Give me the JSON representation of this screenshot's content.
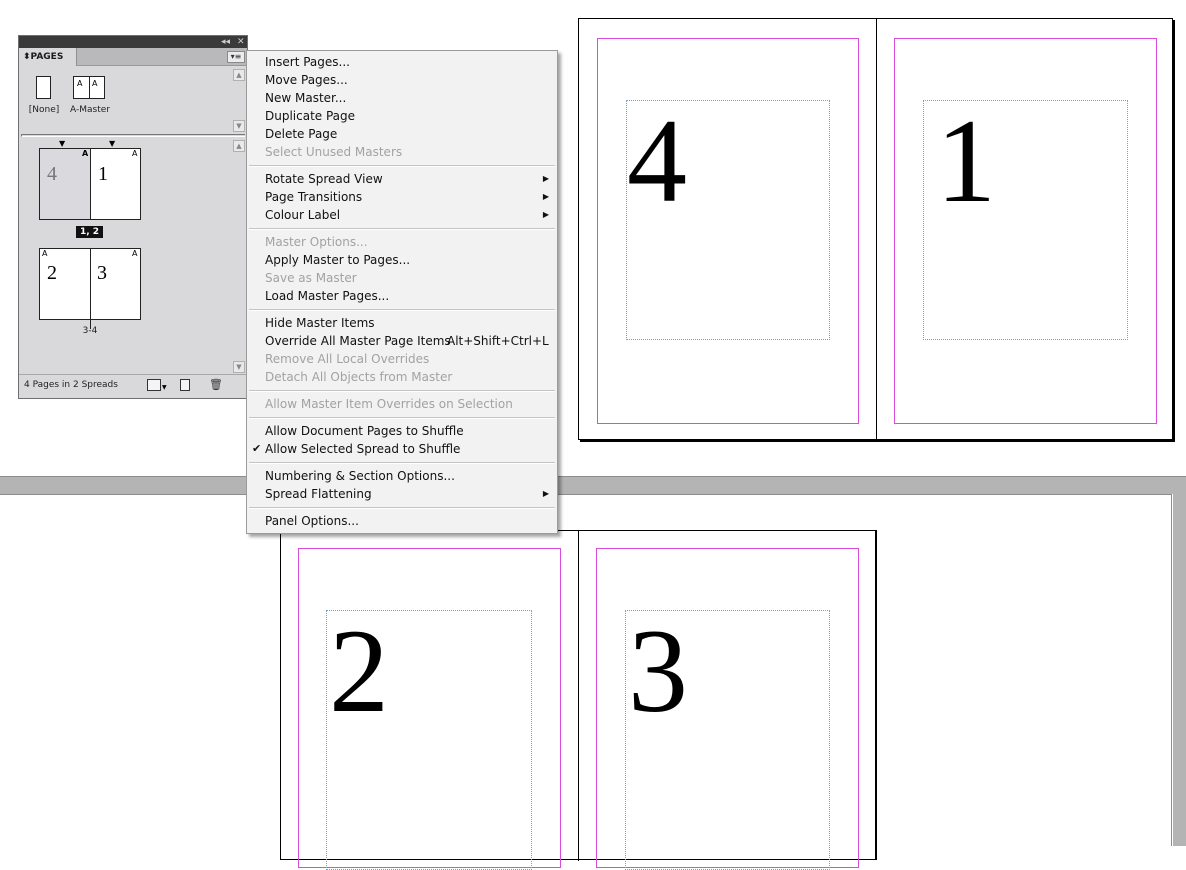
{
  "pages_panel": {
    "tab_title": "PAGES",
    "collapse_glyph": "◂◂",
    "close_glyph": "✕",
    "menu_glyph": "▾≡",
    "masters": [
      {
        "label": "[None]"
      },
      {
        "label": "A-Master",
        "left_prefix": "A",
        "right_prefix": "A"
      }
    ],
    "spreads": [
      {
        "left_page": "4",
        "right_page": "1",
        "label": "1, 2",
        "selected": true,
        "left_prefix": "",
        "right_prefix": "A",
        "center_prefix": "A"
      },
      {
        "left_page": "2",
        "right_page": "3",
        "label": "3-4",
        "selected": false,
        "left_prefix": "A",
        "right_prefix": "A"
      }
    ],
    "status": "4 Pages in 2 Spreads",
    "icons": [
      "edit-page-size-icon",
      "new-page-icon",
      "delete-page-icon"
    ]
  },
  "context_menu": {
    "items": [
      {
        "label": "Insert Pages...",
        "enabled": true
      },
      {
        "label": "Move Pages...",
        "enabled": true
      },
      {
        "label": "New Master...",
        "enabled": true
      },
      {
        "label": "Duplicate Page",
        "enabled": true
      },
      {
        "label": "Delete Page",
        "enabled": true
      },
      {
        "label": "Select Unused Masters",
        "enabled": false
      },
      {
        "separator": true
      },
      {
        "label": "Rotate Spread View",
        "enabled": true,
        "submenu": true
      },
      {
        "label": "Page Transitions",
        "enabled": true,
        "submenu": true
      },
      {
        "label": "Colour Label",
        "enabled": true,
        "submenu": true
      },
      {
        "separator": true
      },
      {
        "label": "Master Options...",
        "enabled": false
      },
      {
        "label": "Apply Master to Pages...",
        "enabled": true
      },
      {
        "label": "Save as Master",
        "enabled": false
      },
      {
        "label": "Load Master Pages...",
        "enabled": true
      },
      {
        "separator": true
      },
      {
        "label": "Hide Master Items",
        "enabled": true
      },
      {
        "label": "Override All Master Page Items",
        "enabled": true,
        "shortcut": "Alt+Shift+Ctrl+L"
      },
      {
        "label": "Remove All Local Overrides",
        "enabled": false
      },
      {
        "label": "Detach All Objects from Master",
        "enabled": false
      },
      {
        "separator": true
      },
      {
        "label": "Allow Master Item Overrides on Selection",
        "enabled": false
      },
      {
        "separator": true
      },
      {
        "label": "Allow Document Pages to Shuffle",
        "enabled": true
      },
      {
        "label": "Allow Selected Spread to Shuffle",
        "enabled": true,
        "checked": true
      },
      {
        "separator": true
      },
      {
        "label": "Numbering & Section Options...",
        "enabled": true
      },
      {
        "label": "Spread Flattening",
        "enabled": true,
        "submenu": true
      },
      {
        "separator": true
      },
      {
        "label": "Panel Options...",
        "enabled": true
      }
    ]
  },
  "document": {
    "spread1": {
      "left_page": "4",
      "right_page": "1"
    },
    "spread2": {
      "left_page": "2",
      "right_page": "3"
    }
  },
  "colors": {
    "margin_guide": "#d84bdc",
    "frame_guide": "#6fa0d8",
    "pasteboard_gap": "#b4b4b4"
  }
}
